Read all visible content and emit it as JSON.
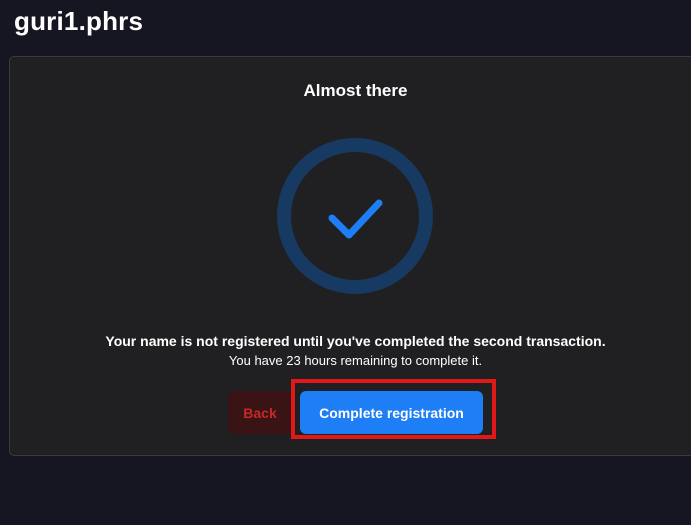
{
  "header": {
    "domain_name": "guri1.phrs"
  },
  "dialog": {
    "title": "Almost there",
    "message_primary": "Your name is not registered until you've completed the second transaction.",
    "message_secondary": "You have 23 hours remaining to complete it.",
    "back_label": "Back",
    "complete_label": "Complete registration",
    "status_icon": "checkmark-icon"
  },
  "colors": {
    "page_bg": "#161622",
    "card_bg": "#202022",
    "ring": "#173a62",
    "check": "#1e7ef5",
    "primary_button": "#1e7ef5",
    "back_button_bg": "#3a1314",
    "back_button_text": "#c62828",
    "highlight_box": "#e01818"
  }
}
